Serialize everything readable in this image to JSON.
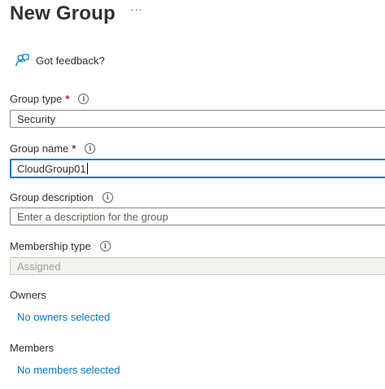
{
  "header": {
    "title": "New Group",
    "more": "···"
  },
  "feedback": {
    "label": "Got feedback?",
    "icon": "feedback-person-icon"
  },
  "colors": {
    "accent": "#0078d4",
    "required": "#a4262c",
    "text": "#323130"
  },
  "form": {
    "group_type": {
      "label": "Group type",
      "required": "*",
      "value": "Security"
    },
    "group_name": {
      "label": "Group name",
      "required": "*",
      "value": "CloudGroup01"
    },
    "group_description": {
      "label": "Group description",
      "placeholder": "Enter a description for the group"
    },
    "membership_type": {
      "label": "Membership type",
      "value": "Assigned"
    },
    "owners": {
      "label": "Owners",
      "link": "No owners selected"
    },
    "members": {
      "label": "Members",
      "link": "No members selected"
    }
  }
}
